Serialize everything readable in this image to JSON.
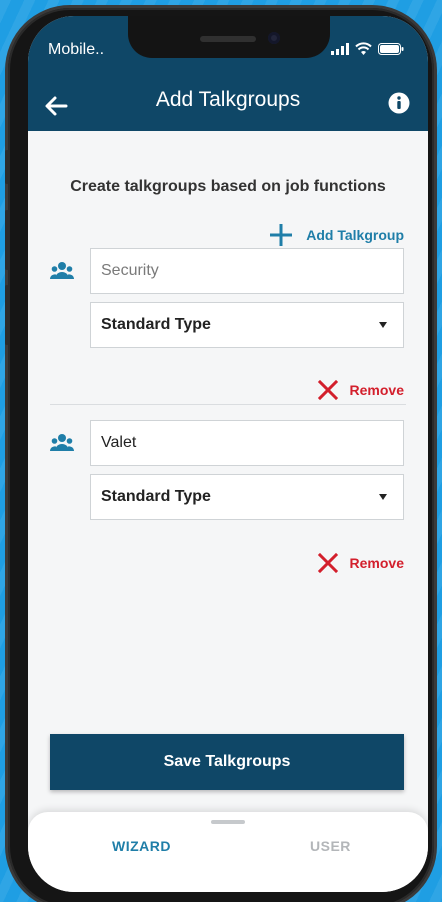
{
  "status_bar": {
    "carrier": "Mobile.."
  },
  "header": {
    "title": "Add Talkgroups",
    "back_icon": "arrow-left-icon",
    "info_icon": "info-icon"
  },
  "subtitle": "Create talkgroups based on job functions",
  "add_talkgroup": {
    "label": "Add Talkgroup",
    "icon": "plus-icon"
  },
  "talkgroups": [
    {
      "name_value": "",
      "name_placeholder": "Security",
      "type": "Standard Type",
      "remove_label": "Remove"
    },
    {
      "name_value": "Valet",
      "name_placeholder": "",
      "type": "Standard Type",
      "remove_label": "Remove"
    }
  ],
  "save_button": {
    "label": "Save Talkgroups"
  },
  "bottom_tabs": [
    {
      "label": "WIZARD",
      "active": true
    },
    {
      "label": "USER",
      "active": false
    }
  ],
  "colors": {
    "header_bg": "#0f4767",
    "accent_blue": "#1f7ea8",
    "remove_red": "#d31f2c",
    "background": "#f5f6f7"
  }
}
